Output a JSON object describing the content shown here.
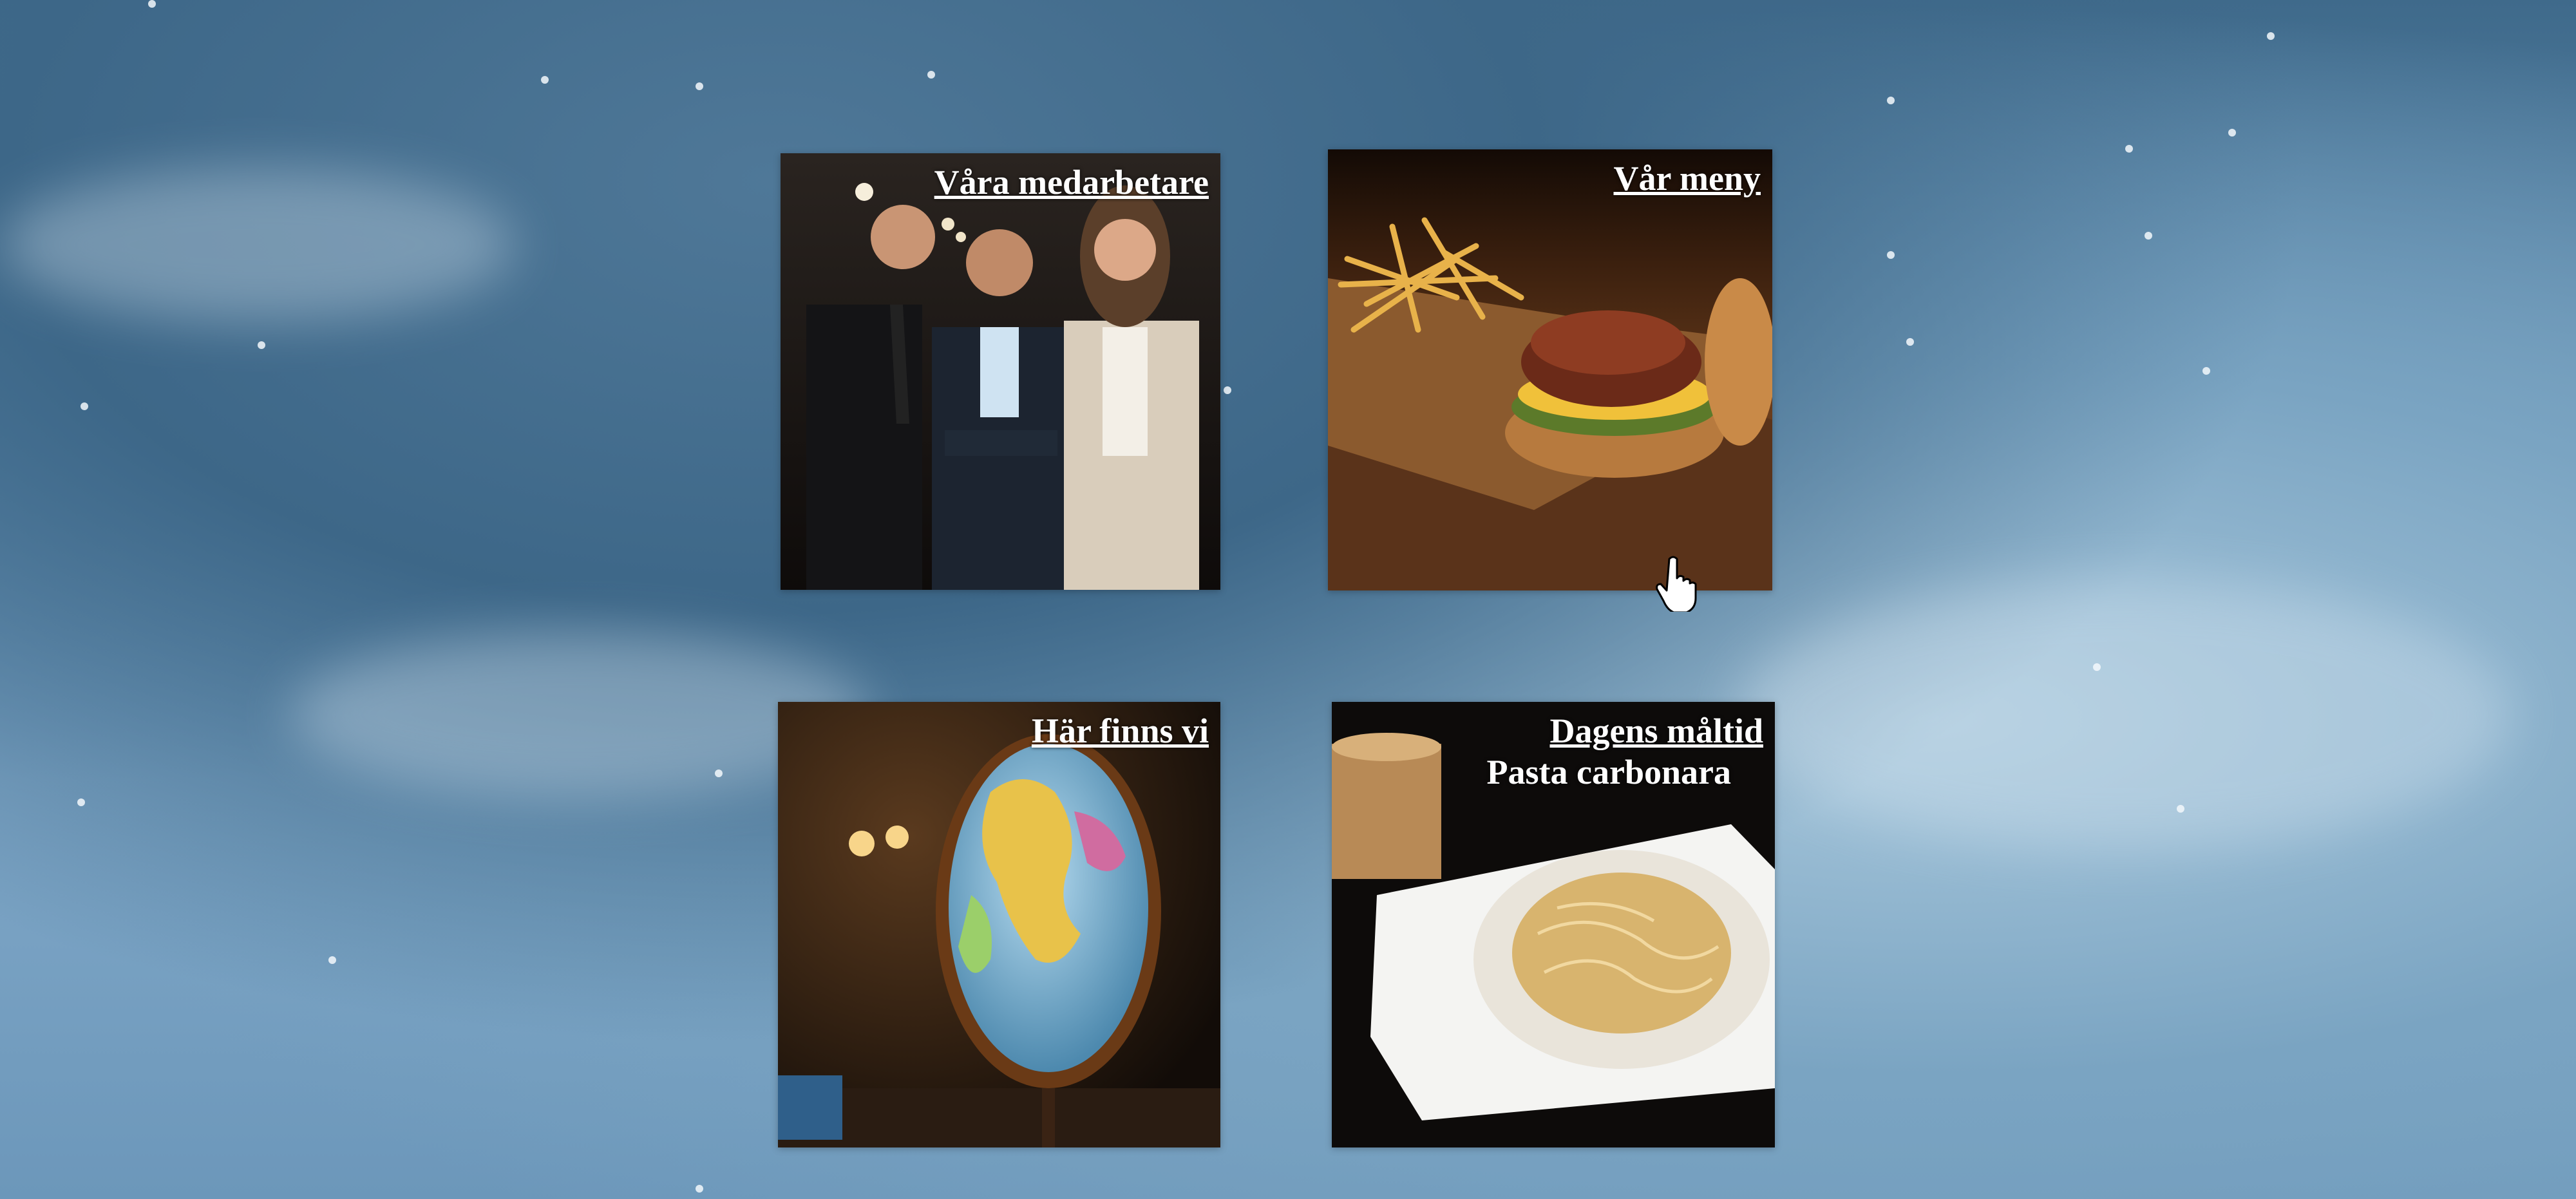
{
  "tiles": [
    {
      "title": "Våra medarbetare",
      "image": "team-photo"
    },
    {
      "title": "Vår meny",
      "image": "burger-photo"
    },
    {
      "title": "Här finns vi",
      "image": "globe-photo"
    },
    {
      "title": "Dagens måltid",
      "subtitle": "Pasta carbonara",
      "image": "pasta-photo"
    }
  ],
  "icons": {
    "cursor": "hand-pointer-icon"
  }
}
